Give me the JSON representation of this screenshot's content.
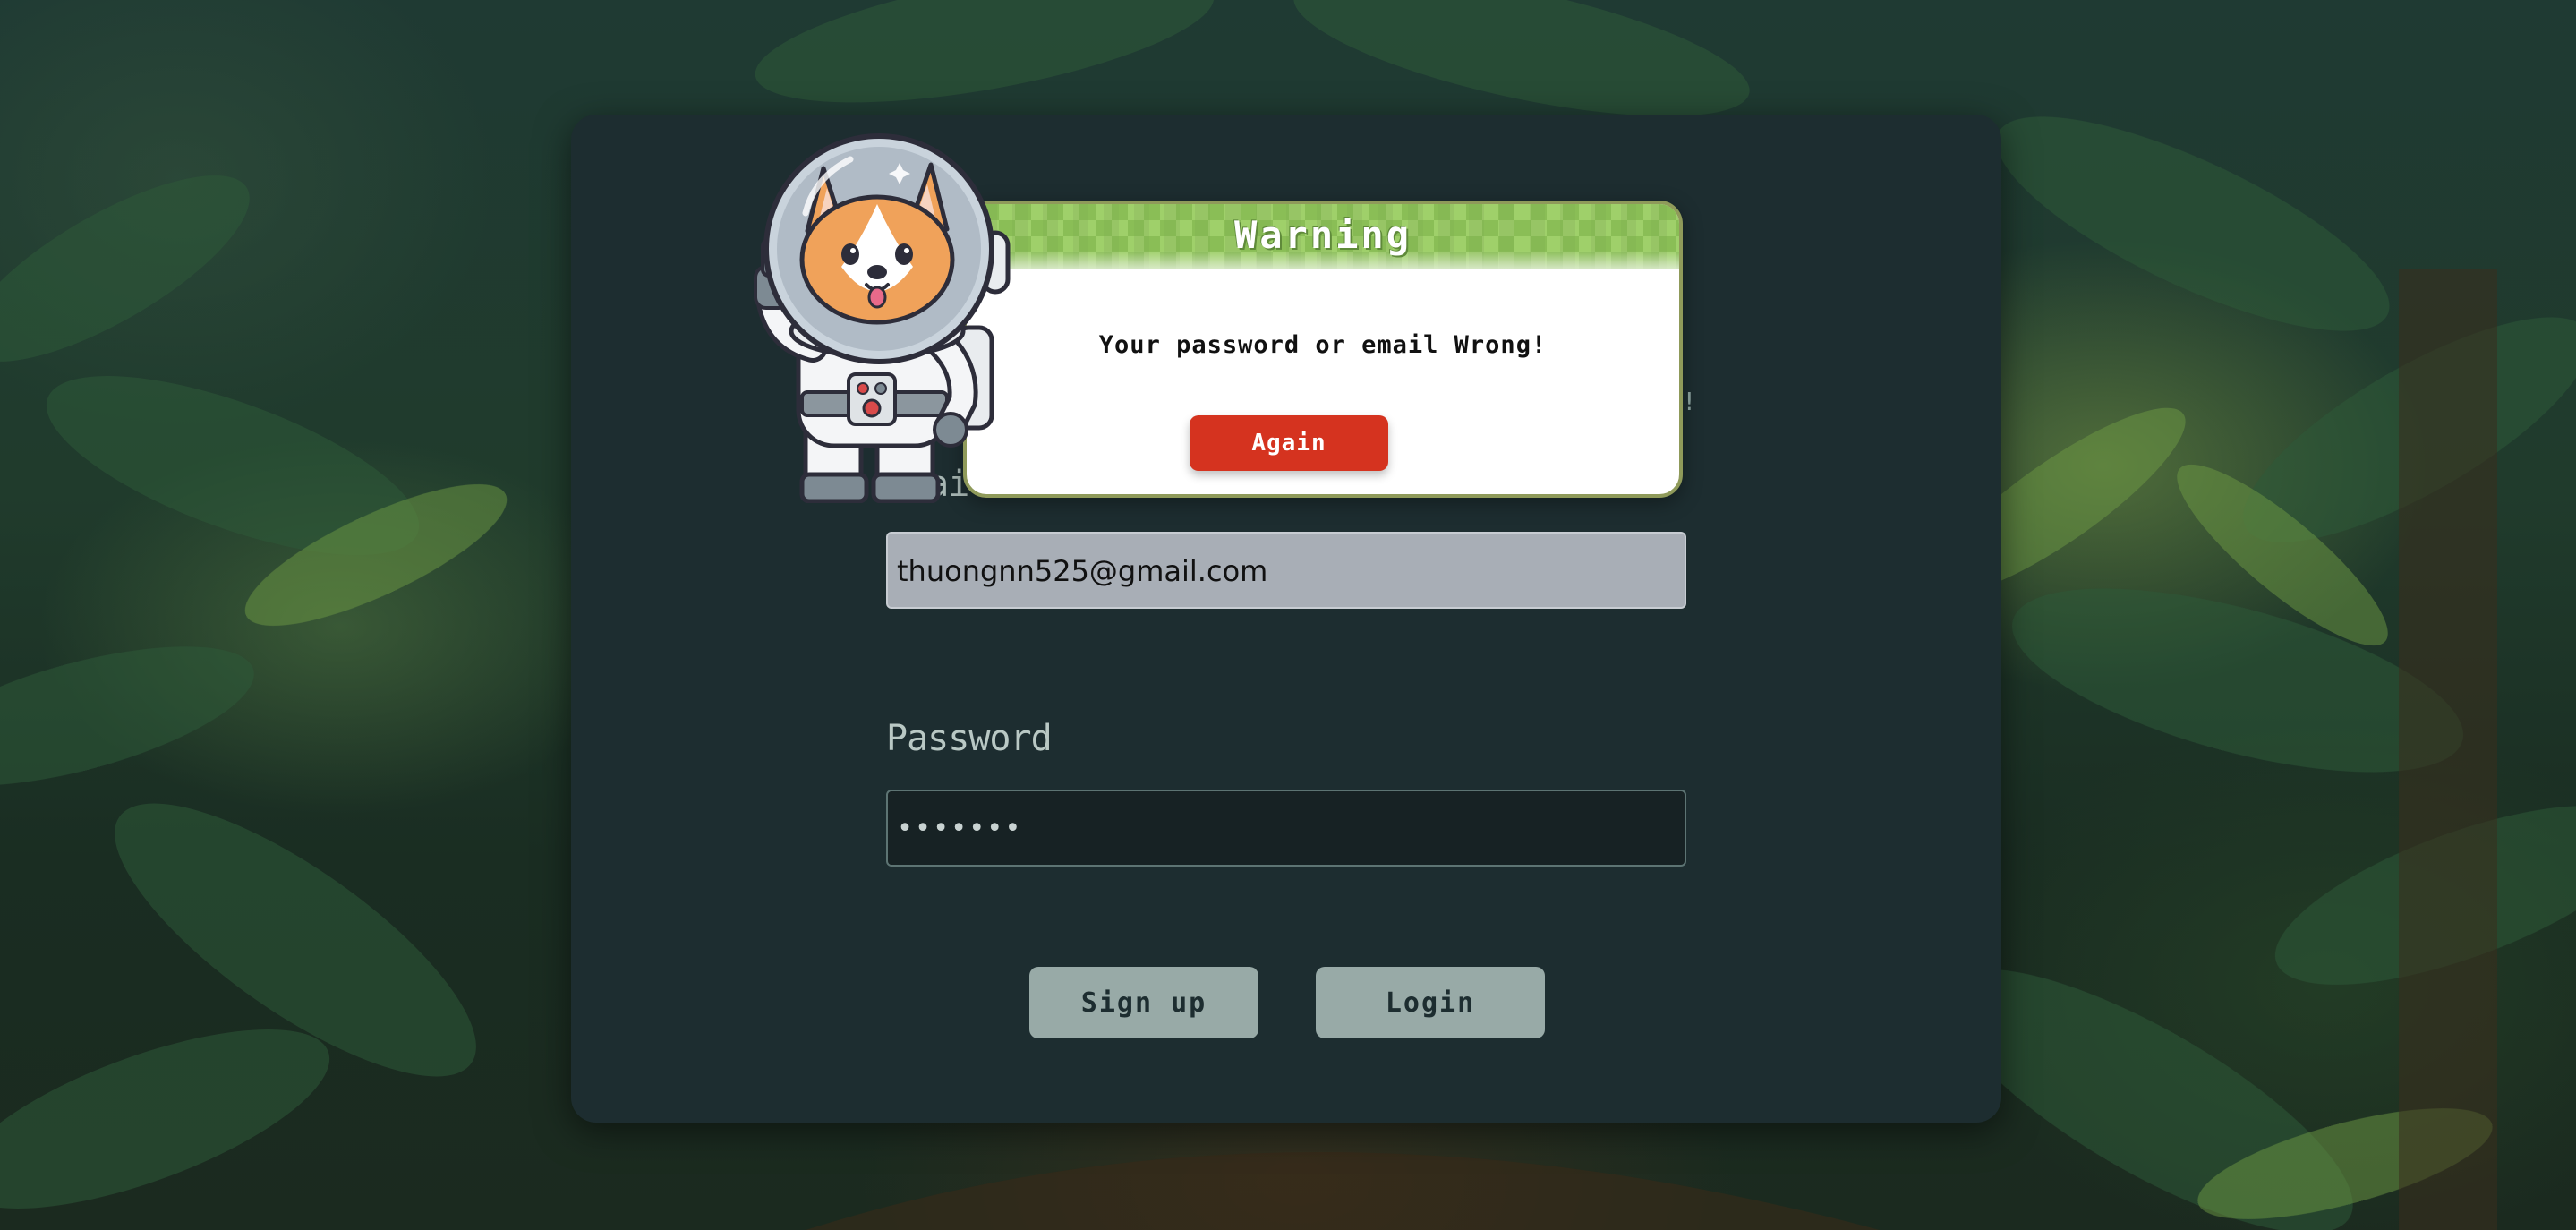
{
  "colors": {
    "card_bg": "#1d2d30",
    "button_bg": "#98aaa7",
    "again_button_bg": "#d5331f",
    "dialog_header": "#9fd06a",
    "email_input_bg": "#a8aeb6",
    "password_input_bg": "#172224"
  },
  "background": {
    "icon": "jungle-background-image"
  },
  "login_form": {
    "email_label": "Email",
    "email_value": "thuongnn525@gmail.com",
    "password_label": "Password",
    "password_value": "•••••••",
    "partial_caption": "f!",
    "signup_label": "Sign up",
    "login_label": "Login"
  },
  "warning_dialog": {
    "title": "Warning",
    "message": "Your password or email Wrong!",
    "again_label": "Again",
    "mascot_icon": "astronaut-corgi-illustration"
  }
}
